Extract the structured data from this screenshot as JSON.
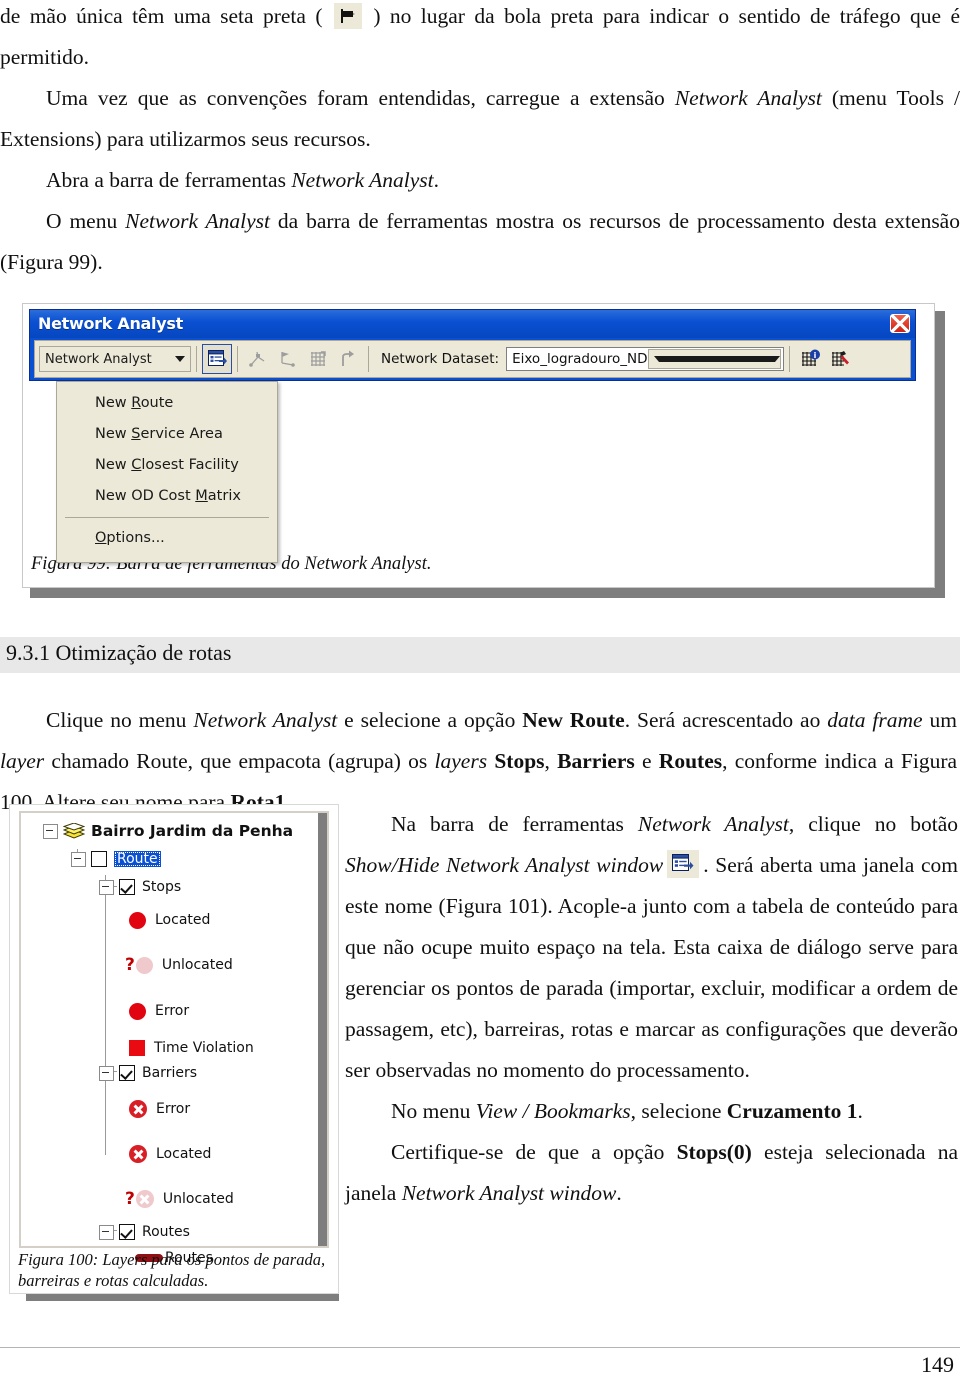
{
  "document": {
    "page_number": "149"
  },
  "top_text": {
    "line1_before_icon": "de mão única têm uma seta preta (",
    "icon_name": "black-arrow-flag-icon",
    "line1_after_icon": ") no lugar da bola preta para indicar o sentido de tráfego que é permitido.",
    "para2_a": "Uma vez que as convenções foram entendidas, carregue a extensão ",
    "para2_i1": "Network Analyst",
    "para2_b": " (menu Tools / Extensions) para utilizarmos seus recursos.",
    "para3_a": "Abra a barra de ferramentas ",
    "para3_i1": "Network Analyst",
    "para3_b": ".",
    "para4_a": "O menu ",
    "para4_i1": "Network Analyst",
    "para4_b": " da barra de ferramentas mostra os recursos de processamento desta extensão (Figura 99)."
  },
  "figure99": {
    "caption": "Figura 99: Barra de ferramentas do Network Analyst.",
    "window_title": "Network Analyst",
    "close_icon": "close-icon",
    "dropdown_label": "Network Analyst",
    "dropdown_caret_icon": "chevron-down-icon",
    "buttons": [
      {
        "name": "show-hide-network-analyst-window-icon",
        "state": "pressed"
      },
      {
        "name": "create-network-location-icon",
        "state": "disabled"
      },
      {
        "name": "select-network-location-icon",
        "state": "disabled"
      },
      {
        "name": "build-network-icon",
        "state": "disabled"
      },
      {
        "name": "directions-icon",
        "state": "disabled"
      }
    ],
    "dataset_label": "Network Dataset:",
    "dataset_value": "Eixo_logradouro_ND",
    "dataset_caret_icon": "chevron-down-icon",
    "right_buttons": [
      {
        "name": "network-identify-icon"
      },
      {
        "name": "network-build-tool-icon"
      }
    ],
    "menu_items": [
      {
        "pre": "New ",
        "accel": "R",
        "post": "oute"
      },
      {
        "pre": "New ",
        "accel": "S",
        "post": "ervice Area"
      },
      {
        "pre": "New ",
        "accel": "C",
        "post": "losest Facility"
      },
      {
        "pre": "New OD Cost ",
        "accel": "M",
        "post": "atrix"
      }
    ],
    "menu_options": {
      "pre": "",
      "accel": "O",
      "post": "ptions..."
    }
  },
  "section": {
    "heading": "9.3.1 Otimização de rotas"
  },
  "mid_para": {
    "t1": "Clique no menu ",
    "i1": "Network Analyst",
    "t2": " e selecione a opção ",
    "b1": "New Route",
    "t3": ". Será acrescentado ao ",
    "i2": "data frame",
    "t4": " um ",
    "i3": "layer",
    "t5": " chamado Route, que empacota (agrupa) os ",
    "i4": "layers",
    "t6": " ",
    "b2": "Stops",
    "t7": ", ",
    "b3": "Barriers",
    "t8": " e ",
    "b4": "Routes",
    "t9": ", conforme indica a Figura 100. Altere seu nome para ",
    "b5": "Rota1",
    "t10": "."
  },
  "figure100": {
    "caption": "Figura 100: Layers para os pontos de parada, barreiras e rotas calculadas.",
    "tree": [
      {
        "label": "Bairro Jardim da Penha",
        "level": 0,
        "type": "group",
        "icon": "layer-stack-icon",
        "expander": true
      },
      {
        "label": "Route",
        "level": 1,
        "type": "layer",
        "checkbox": "unchecked",
        "selected": true,
        "expander": true
      },
      {
        "label": "Stops",
        "level": 2,
        "type": "layer",
        "checkbox": "checked",
        "expander": true
      },
      {
        "label": "Located",
        "level": 3,
        "type": "symbol",
        "symbol": "red-circle-icon",
        "color": "#e00511"
      },
      {
        "label": "Unlocated",
        "level": 3,
        "type": "symbol",
        "symbol": "question-faded-circle-icon",
        "color": "#f0c9cc"
      },
      {
        "label": "Error",
        "level": 3,
        "type": "symbol",
        "symbol": "red-circle-icon",
        "color": "#e00511"
      },
      {
        "label": "Time Violation",
        "level": 3,
        "type": "symbol",
        "symbol": "red-square-icon",
        "color": "#ea0b12"
      },
      {
        "label": "Barriers",
        "level": 2,
        "type": "layer",
        "checkbox": "checked",
        "expander": true
      },
      {
        "label": "Error",
        "level": 3,
        "type": "symbol",
        "symbol": "red-x-circle-icon",
        "color": "#d81f26"
      },
      {
        "label": "Located",
        "level": 3,
        "type": "symbol",
        "symbol": "red-x-circle-icon",
        "color": "#d81f26"
      },
      {
        "label": "Unlocated",
        "level": 3,
        "type": "symbol",
        "symbol": "question-faded-x-circle-icon",
        "color": "#f0c9cc"
      },
      {
        "label": "Routes",
        "level": 2,
        "type": "layer",
        "checkbox": "checked",
        "expander": true
      },
      {
        "label": "Routes",
        "level": 3,
        "type": "symbol",
        "symbol": "dark-red-line-icon",
        "color": "#8f1014"
      }
    ]
  },
  "right_text": {
    "p1_t1": "Na barra de ferramentas ",
    "p1_i1": "Network Analyst",
    "p1_t2": ", clique no botão ",
    "p1_i2": "Show/Hide Network Analyst window",
    "p1_icon": "show-hide-network-analyst-window-icon",
    "p1_t3": ". Será aberta uma janela com este nome (Figura 101). Acople-a junto com a tabela de conteúdo para que não ocupe muito espaço na tela. Esta caixa de diálogo serve para gerenciar os pontos de parada (importar, excluir, modificar a ordem de passagem, etc), barreiras, rotas e marcar as configurações que deverão ser observadas no momento do processamento.",
    "p2_t1": "No menu ",
    "p2_i1": "View / Bookmarks",
    "p2_t2": ", selecione ",
    "p2_b1": "Cruzamento 1",
    "p2_t3": ".",
    "p3_t1": "Certifique-se de que a opção ",
    "p3_b1": "Stops(0)",
    "p3_t2": " esteja selecionada na janela ",
    "p3_i1": "Network Analyst window",
    "p3_t3": "."
  }
}
